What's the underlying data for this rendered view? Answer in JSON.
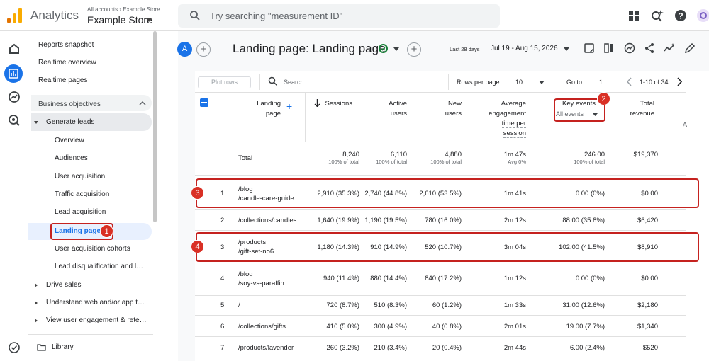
{
  "topbar": {
    "app_title": "Analytics",
    "account_path": "All accounts › Example Store",
    "account_name": "Example Store",
    "search_placeholder": "Try searching \"measurement ID\"",
    "icons": [
      "apps-icon",
      "search-insights-icon",
      "help-icon",
      "account-icon"
    ]
  },
  "nav": {
    "reports_snapshot": "Reports snapshot",
    "realtime_overview": "Realtime overview",
    "realtime_pages": "Realtime pages",
    "business_objectives": "Business objectives",
    "generate_leads": "Generate leads",
    "sub_items": [
      "Overview",
      "Audiences",
      "User acquisition",
      "Traffic acquisition",
      "Lead acquisition",
      "Landing page",
      "User acquisition cohorts",
      "Lead disqualification and l…"
    ],
    "drive_sales": "Drive sales",
    "understand_web": "Understand web and/or app t…",
    "view_engagement": "View user engagement & rete…",
    "library": "Library"
  },
  "header": {
    "avatar_letter": "A",
    "title": "Landing page: Landing page",
    "date_label": "Last 28 days",
    "date_range": "Jul 19 - Aug 15, 2026"
  },
  "toolbar": {
    "plot_rows": "Plot rows",
    "search_placeholder": "Search...",
    "rows_per_page_label": "Rows per page:",
    "rows_per_page_value": "10",
    "goto_label": "Go to:",
    "goto_value": "1",
    "pagination": "1-10 of 34"
  },
  "columns": {
    "landing_page": [
      "Landing",
      "page"
    ],
    "sessions": "Sessions",
    "active_users": [
      "Active",
      "users"
    ],
    "new_users": [
      "New",
      "users"
    ],
    "avg_engagement": [
      "Average",
      "engagement",
      "time per",
      "session"
    ],
    "key_events": "Key events",
    "key_events_filter": "All events",
    "total_revenue": [
      "Total",
      "revenue"
    ],
    "cut_off": "A"
  },
  "totals": {
    "label": "Total",
    "sessions": "8,240",
    "sessions_sub": "100% of total",
    "active_users": "6,110",
    "active_users_sub": "100% of total",
    "new_users": "4,880",
    "new_users_sub": "100% of total",
    "avg_engagement": "1m 47s",
    "avg_engagement_sub": "Avg 0%",
    "key_events": "246.00",
    "key_events_sub": "100% of total",
    "revenue": "$19,370"
  },
  "rows": [
    {
      "num": "1",
      "page": [
        "/blog",
        "/candle-care-guide"
      ],
      "sessions": "2,910 (35.3%)",
      "active_users": "2,740 (44.8%)",
      "new_users": "2,610 (53.5%)",
      "avg": "1m 41s",
      "key_events": "0.00 (0%)",
      "revenue": "$0.00"
    },
    {
      "num": "2",
      "page": [
        "/collections/candles"
      ],
      "sessions": "1,640 (19.9%)",
      "active_users": "1,190 (19.5%)",
      "new_users": "780 (16.0%)",
      "avg": "2m 12s",
      "key_events": "88.00 (35.8%)",
      "revenue": "$6,420"
    },
    {
      "num": "3",
      "page": [
        "/products",
        "/gift-set-no6"
      ],
      "sessions": "1,180 (14.3%)",
      "active_users": "910 (14.9%)",
      "new_users": "520 (10.7%)",
      "avg": "3m 04s",
      "key_events": "102.00 (41.5%)",
      "revenue": "$8,910"
    },
    {
      "num": "4",
      "page": [
        "/blog",
        "/soy-vs-paraffin"
      ],
      "sessions": "940 (11.4%)",
      "active_users": "880 (14.4%)",
      "new_users": "840 (17.2%)",
      "avg": "1m 12s",
      "key_events": "0.00 (0%)",
      "revenue": "$0.00"
    },
    {
      "num": "5",
      "page": [
        "/"
      ],
      "sessions": "720 (8.7%)",
      "active_users": "510 (8.3%)",
      "new_users": "60 (1.2%)",
      "avg": "1m 33s",
      "key_events": "31.00 (12.6%)",
      "revenue": "$2,180"
    },
    {
      "num": "6",
      "page": [
        "/collections/gifts"
      ],
      "sessions": "410 (5.0%)",
      "active_users": "300 (4.9%)",
      "new_users": "40 (0.8%)",
      "avg": "2m 01s",
      "key_events": "19.00 (7.7%)",
      "revenue": "$1,340"
    },
    {
      "num": "7",
      "page": [
        "/products/lavender"
      ],
      "sessions": "260 (3.2%)",
      "active_users": "210 (3.4%)",
      "new_users": "20 (0.4%)",
      "avg": "2m 44s",
      "key_events": "6.00 (2.4%)",
      "revenue": "$520"
    }
  ],
  "annotations": [
    "1",
    "2",
    "3",
    "4"
  ],
  "colors": {
    "accent": "#1a73e8",
    "annotation_red": "#d93025",
    "success_green": "#188038",
    "logo_orange": "#f9ab00",
    "logo_dark_orange": "#e37400"
  }
}
